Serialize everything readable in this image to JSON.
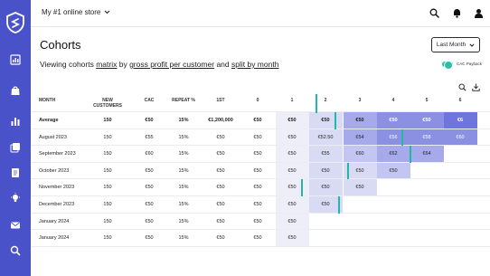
{
  "store": {
    "name": "My #1 online store"
  },
  "page": {
    "title": "Cohorts",
    "period_button": "Last Month",
    "sentence": {
      "prefix": "Viewing cohorts ",
      "matrix": "matrix",
      "by": " by ",
      "metric": "gross profit per customer",
      "and": " and ",
      "split": "split by month"
    },
    "toggle_label": "CAC Payback",
    "toggle_on": true
  },
  "table": {
    "columns": [
      "MONTH",
      "NEW CUSTOMERS",
      "CAC",
      "REPEAT %",
      "1ST",
      "0",
      "1",
      "2",
      "3",
      "4",
      "5",
      "6"
    ],
    "rows": [
      {
        "month": "Average",
        "new_customers": "150",
        "cac": "€50",
        "repeat": "15%",
        "first": "€1,200,000",
        "cohort": [
          "€50",
          "€50",
          "€50",
          "€50",
          "€50",
          "€50",
          "€6"
        ]
      },
      {
        "month": "August 2023",
        "new_customers": "150",
        "cac": "€55",
        "repeat": "15%",
        "first": "€50",
        "cohort": [
          "€50",
          "€50",
          "€52.50",
          "€54",
          "€56",
          "€58",
          "€60"
        ]
      },
      {
        "month": "September 2023",
        "new_customers": "150",
        "cac": "€60",
        "repeat": "15%",
        "first": "€50",
        "cohort": [
          "€50",
          "€50",
          "€55",
          "€60",
          "€62",
          "€64"
        ]
      },
      {
        "month": "October 2023",
        "new_customers": "150",
        "cac": "€50",
        "repeat": "15%",
        "first": "€50",
        "cohort": [
          "€50",
          "€50",
          "€50",
          "€50",
          "€50"
        ]
      },
      {
        "month": "November 2023",
        "new_customers": "150",
        "cac": "€50",
        "repeat": "15%",
        "first": "€50",
        "cohort": [
          "€50",
          "€50",
          "€50",
          "€50"
        ]
      },
      {
        "month": "December 2023",
        "new_customers": "150",
        "cac": "€50",
        "repeat": "15%",
        "first": "€50",
        "cohort": [
          "€50",
          "€50",
          "€50"
        ]
      },
      {
        "month": "January 2024",
        "new_customers": "150",
        "cac": "€50",
        "repeat": "15%",
        "first": "€50",
        "cohort": [
          "€50",
          "€50"
        ]
      },
      {
        "month": "January  2024",
        "new_customers": "150",
        "cac": "€50",
        "repeat": "15%",
        "first": "€50",
        "cohort": [
          "€50",
          "€50"
        ]
      }
    ]
  },
  "colors": {
    "sidebar": "#4a52c9",
    "accent": "#23b8a6",
    "shade_light": "#eeeef9",
    "shade_1": "#d9dbf5",
    "shade_2": "#c3c6f0",
    "shade_3": "#a6aaea",
    "shade_4": "#8b90e3",
    "shade_5": "#6f75dc"
  },
  "icons": {
    "sidebar": [
      "logo-shield-icon",
      "dashboard-icon",
      "shopping-bag-icon",
      "bar-chart-icon",
      "gallery-icon",
      "document-icon",
      "lightbulb-icon",
      "mail-icon",
      "search-icon"
    ],
    "top": [
      "search-icon",
      "bell-icon",
      "user-icon"
    ]
  }
}
